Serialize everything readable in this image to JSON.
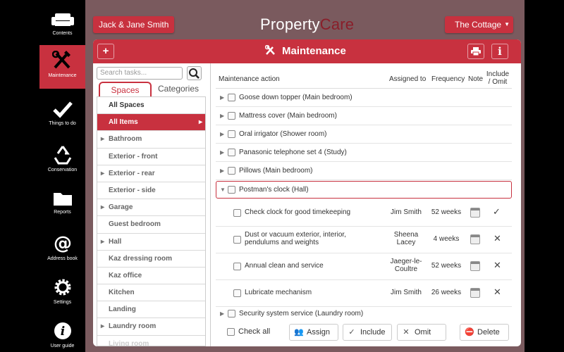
{
  "nav": [
    {
      "label": "Contents",
      "icon": "sofa-icon"
    },
    {
      "label": "Maintenance",
      "icon": "tools-icon"
    },
    {
      "label": "Things to do",
      "icon": "checkmark-icon"
    },
    {
      "label": "Conservation",
      "icon": "recycle-icon"
    },
    {
      "label": "Reports",
      "icon": "folder-icon"
    },
    {
      "label": "Address book",
      "icon": "at-icon"
    },
    {
      "label": "Settings",
      "icon": "gear-icon"
    },
    {
      "label": "User guide",
      "icon": "info-icon"
    }
  ],
  "header": {
    "owner_button": "Jack & Jane Smith",
    "brand_property": "Property",
    "brand_care": "Care",
    "property_button": "The Cottage"
  },
  "panel": {
    "add_label": "+",
    "title": "Maintenance",
    "info_label": "i"
  },
  "left": {
    "search_placeholder": "Search tasks...",
    "tab_spaces": "Spaces",
    "tab_categories": "Categories",
    "items": [
      "All Spaces",
      "All Items",
      "Bathroom",
      "Exterior - front",
      "Exterior - rear",
      "Exterior - side",
      "Garage",
      "Guest bedroom",
      "Hall",
      "Kaz dressing room",
      "Kaz office",
      "Kitchen",
      "Landing",
      "Laundry room",
      "Living room"
    ]
  },
  "table": {
    "col_action": "Maintenance action",
    "col_assigned": "Assigned to",
    "col_frequency": "Frequency",
    "col_note": "Note",
    "col_include_1": "Include",
    "col_include_2": "/ Omit",
    "items": [
      "Goose down topper (Main bedroom)",
      "Mattress cover (Main bedroom)",
      "Oral irrigator (Shower room)",
      "Panasonic telephone set 4 (Study)",
      "Pillows (Main bedroom)",
      "Postman's clock (Hall)",
      "Security system service (Laundry room)"
    ],
    "subtasks": [
      {
        "action": "Check clock for good timekeeping",
        "assigned": "Jim Smith",
        "frequency": "52 weeks",
        "mark": "✓"
      },
      {
        "action": "Dust or vacuum exterior, interior, pendulums and weights",
        "assigned": "Sheena Lacey",
        "frequency": "4 weeks",
        "mark": "✕"
      },
      {
        "action": "Annual clean and service",
        "assigned": "Jaeger-le-Coultre",
        "frequency": "52 weeks",
        "mark": "✕"
      },
      {
        "action": "Lubricate mechanism",
        "assigned": "Jim Smith",
        "frequency": "26 weeks",
        "mark": "✕"
      }
    ]
  },
  "bottom": {
    "check_all": "Check all",
    "assign": "Assign",
    "include": "Include",
    "omit": "Omit",
    "delete": "Delete"
  }
}
